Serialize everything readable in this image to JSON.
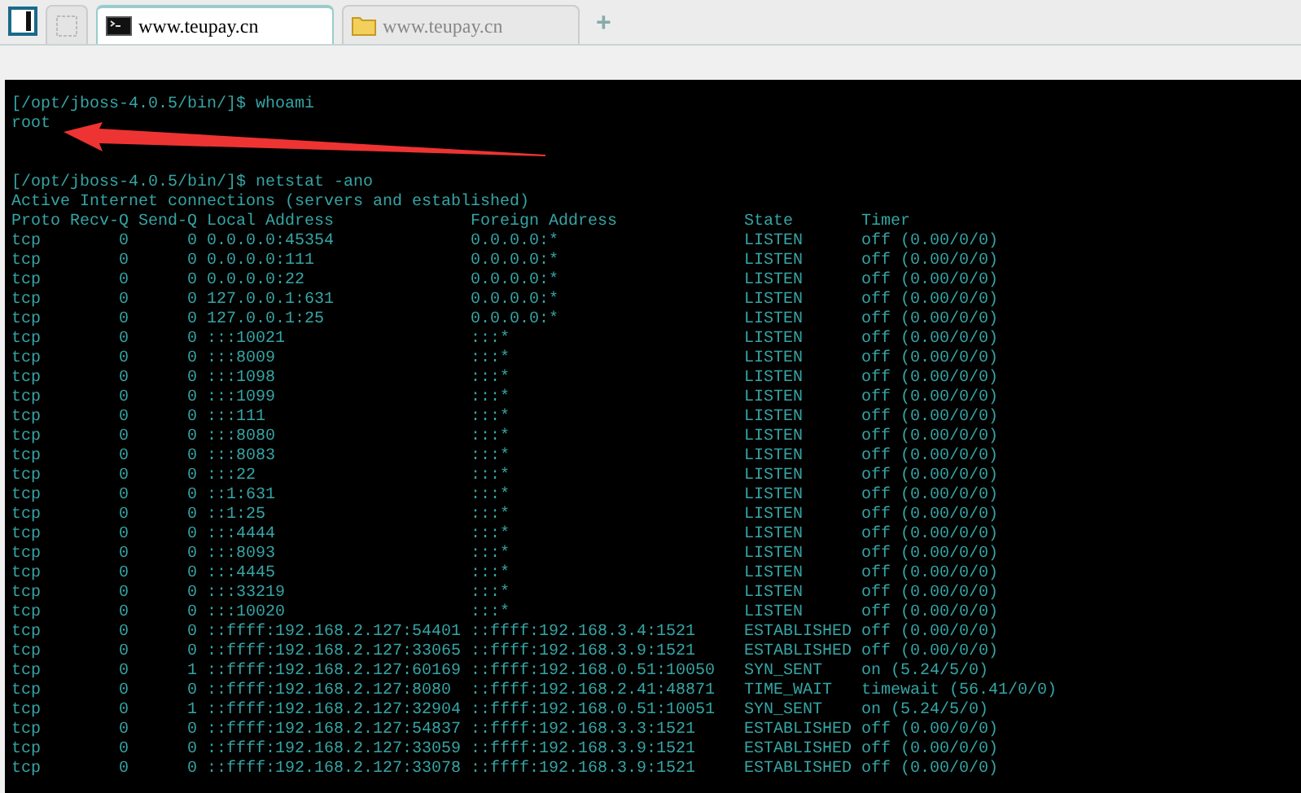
{
  "tabs": [
    {
      "kind": "blank",
      "selected": false
    },
    {
      "kind": "terminal",
      "label": "www.teupay.cn",
      "selected": true
    },
    {
      "kind": "folder",
      "label": "www.teupay.cn",
      "selected": false
    }
  ],
  "new_tab": "+",
  "terminal": {
    "lines": [
      {
        "kind": "command",
        "prompt": "[/opt/jboss-4.0.5/bin/]$",
        "command": "whoami"
      },
      {
        "kind": "output",
        "text": "root"
      },
      {
        "kind": "blank"
      },
      {
        "kind": "blank"
      },
      {
        "kind": "command",
        "prompt": "[/opt/jboss-4.0.5/bin/]$",
        "command": "netstat -ano"
      },
      {
        "kind": "output",
        "text": "Active Internet connections (servers and established)"
      }
    ],
    "columns": [
      "Proto",
      "Recv-Q",
      "Send-Q",
      "Local Address",
      "Foreign Address",
      "State",
      "Timer"
    ],
    "rows": [
      [
        "tcp",
        "0",
        "0",
        "0.0.0.0:45354",
        "0.0.0.0:*",
        "LISTEN",
        "off (0.00/0/0)"
      ],
      [
        "tcp",
        "0",
        "0",
        "0.0.0.0:111",
        "0.0.0.0:*",
        "LISTEN",
        "off (0.00/0/0)"
      ],
      [
        "tcp",
        "0",
        "0",
        "0.0.0.0:22",
        "0.0.0.0:*",
        "LISTEN",
        "off (0.00/0/0)"
      ],
      [
        "tcp",
        "0",
        "0",
        "127.0.0.1:631",
        "0.0.0.0:*",
        "LISTEN",
        "off (0.00/0/0)"
      ],
      [
        "tcp",
        "0",
        "0",
        "127.0.0.1:25",
        "0.0.0.0:*",
        "LISTEN",
        "off (0.00/0/0)"
      ],
      [
        "tcp",
        "0",
        "0",
        ":::10021",
        ":::*",
        "LISTEN",
        "off (0.00/0/0)"
      ],
      [
        "tcp",
        "0",
        "0",
        ":::8009",
        ":::*",
        "LISTEN",
        "off (0.00/0/0)"
      ],
      [
        "tcp",
        "0",
        "0",
        ":::1098",
        ":::*",
        "LISTEN",
        "off (0.00/0/0)"
      ],
      [
        "tcp",
        "0",
        "0",
        ":::1099",
        ":::*",
        "LISTEN",
        "off (0.00/0/0)"
      ],
      [
        "tcp",
        "0",
        "0",
        ":::111",
        ":::*",
        "LISTEN",
        "off (0.00/0/0)"
      ],
      [
        "tcp",
        "0",
        "0",
        ":::8080",
        ":::*",
        "LISTEN",
        "off (0.00/0/0)"
      ],
      [
        "tcp",
        "0",
        "0",
        ":::8083",
        ":::*",
        "LISTEN",
        "off (0.00/0/0)"
      ],
      [
        "tcp",
        "0",
        "0",
        ":::22",
        ":::*",
        "LISTEN",
        "off (0.00/0/0)"
      ],
      [
        "tcp",
        "0",
        "0",
        "::1:631",
        ":::*",
        "LISTEN",
        "off (0.00/0/0)"
      ],
      [
        "tcp",
        "0",
        "0",
        "::1:25",
        ":::*",
        "LISTEN",
        "off (0.00/0/0)"
      ],
      [
        "tcp",
        "0",
        "0",
        ":::4444",
        ":::*",
        "LISTEN",
        "off (0.00/0/0)"
      ],
      [
        "tcp",
        "0",
        "0",
        ":::8093",
        ":::*",
        "LISTEN",
        "off (0.00/0/0)"
      ],
      [
        "tcp",
        "0",
        "0",
        ":::4445",
        ":::*",
        "LISTEN",
        "off (0.00/0/0)"
      ],
      [
        "tcp",
        "0",
        "0",
        ":::33219",
        ":::*",
        "LISTEN",
        "off (0.00/0/0)"
      ],
      [
        "tcp",
        "0",
        "0",
        ":::10020",
        ":::*",
        "LISTEN",
        "off (0.00/0/0)"
      ],
      [
        "tcp",
        "0",
        "0",
        "::ffff:192.168.2.127:54401",
        "::ffff:192.168.3.4:1521",
        "ESTABLISHED",
        "off (0.00/0/0)"
      ],
      [
        "tcp",
        "0",
        "0",
        "::ffff:192.168.2.127:33065",
        "::ffff:192.168.3.9:1521",
        "ESTABLISHED",
        "off (0.00/0/0)"
      ],
      [
        "tcp",
        "0",
        "1",
        "::ffff:192.168.2.127:60169",
        "::ffff:192.168.0.51:10050",
        "SYN_SENT",
        "on (5.24/5/0)"
      ],
      [
        "tcp",
        "0",
        "0",
        "::ffff:192.168.2.127:8080",
        "::ffff:192.168.2.41:48871",
        "TIME_WAIT",
        "timewait (56.41/0/0)"
      ],
      [
        "tcp",
        "0",
        "1",
        "::ffff:192.168.2.127:32904",
        "::ffff:192.168.0.51:10051",
        "SYN_SENT",
        "on (5.24/5/0)"
      ],
      [
        "tcp",
        "0",
        "0",
        "::ffff:192.168.2.127:54837",
        "::ffff:192.168.3.3:1521",
        "ESTABLISHED",
        "off (0.00/0/0)"
      ],
      [
        "tcp",
        "0",
        "0",
        "::ffff:192.168.2.127:33059",
        "::ffff:192.168.3.9:1521",
        "ESTABLISHED",
        "off (0.00/0/0)"
      ],
      [
        "tcp",
        "0",
        "0",
        "::ffff:192.168.2.127:33078",
        "::ffff:192.168.3.9:1521",
        "ESTABLISHED",
        "off (0.00/0/0)"
      ]
    ]
  }
}
